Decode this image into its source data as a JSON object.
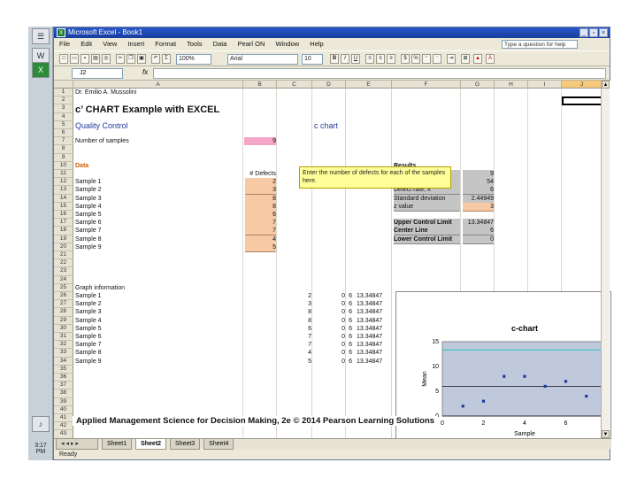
{
  "window": {
    "title": "Microsoft Excel - Book1",
    "min": "_",
    "max": "▫",
    "close": "×"
  },
  "menu": [
    "File",
    "Edit",
    "View",
    "Insert",
    "Format",
    "Tools",
    "Data",
    "Pearl ON",
    "Window",
    "Help"
  ],
  "help_box": {
    "placeholder": "Type a question for help"
  },
  "toolbar": {
    "zoom": "100%",
    "font": "Arial",
    "font_size": "10"
  },
  "formula_bar": {
    "name_box": "J2",
    "fx": "fx",
    "content": ""
  },
  "columns": [
    {
      "label": "",
      "w": 0
    },
    {
      "label": "A"
    },
    {
      "label": "B"
    },
    {
      "label": "C"
    },
    {
      "label": "D"
    },
    {
      "label": "E"
    },
    {
      "label": "F"
    },
    {
      "label": "G"
    },
    {
      "label": "H"
    },
    {
      "label": "I"
    },
    {
      "label": "J"
    }
  ],
  "rows": [
    "1",
    "2",
    "3",
    "4",
    "5",
    "6",
    "7",
    "8",
    "9",
    "10",
    "11",
    "12",
    "13",
    "14",
    "15",
    "16",
    "17",
    "18",
    "19",
    "20",
    "21",
    "22",
    "23",
    "24",
    "25",
    "26",
    "27",
    "28",
    "29",
    "30",
    "31",
    "32",
    "33",
    "34",
    "35",
    "36",
    "37",
    "38",
    "39",
    "40",
    "41",
    "42",
    "43"
  ],
  "sheet": {
    "author": "Dr. Emilio A. Mussolini",
    "title": "c’ CHART Example with EXCEL",
    "qc_label": "Quality Control",
    "chart_label": "c chart",
    "num_samples_label": "Number of samples",
    "num_samples_value": "9",
    "comment": "Enter the number of defects for each of the samples here.",
    "data_label": "Data",
    "defects_header": "# Defects",
    "samples": [
      {
        "name": "Sample 1",
        "defects": "2"
      },
      {
        "name": "Sample 2",
        "defects": "3"
      },
      {
        "name": "Sample 3",
        "defects": "8"
      },
      {
        "name": "Sample 4",
        "defects": "8"
      },
      {
        "name": "Sample 5",
        "defects": "6"
      },
      {
        "name": "Sample 6",
        "defects": "7"
      },
      {
        "name": "Sample 7",
        "defects": "7"
      },
      {
        "name": "Sample 8",
        "defects": "4"
      },
      {
        "name": "Sample 9",
        "defects": "5"
      }
    ],
    "results": {
      "header": "Results",
      "rows": [
        {
          "label": "Total units sampled",
          "value": "9"
        },
        {
          "label": "Total Defects",
          "value": "54"
        },
        {
          "label": "Defect rate, λ",
          "value": "6"
        },
        {
          "label": "Standard deviation",
          "value": "2.44949"
        },
        {
          "label": "z value",
          "value": "3"
        }
      ],
      "limits": [
        {
          "label": "Upper Control Limit",
          "value": "13.34847"
        },
        {
          "label": "Center Line",
          "value": "6"
        },
        {
          "label": "Lower Control Limit",
          "value": "0"
        }
      ]
    },
    "graph_info": {
      "label": "Graph information",
      "rows": [
        {
          "name": "Sample 1",
          "c": "2",
          "lcl": "0",
          "cl": "6",
          "ucl": "13.34847"
        },
        {
          "name": "Sample 2",
          "c": "3",
          "lcl": "0",
          "cl": "6",
          "ucl": "13.34847"
        },
        {
          "name": "Sample 3",
          "c": "8",
          "lcl": "0",
          "cl": "6",
          "ucl": "13.34847"
        },
        {
          "name": "Sample 4",
          "c": "8",
          "lcl": "0",
          "cl": "6",
          "ucl": "13.34847"
        },
        {
          "name": "Sample 5",
          "c": "6",
          "lcl": "0",
          "cl": "6",
          "ucl": "13.34847"
        },
        {
          "name": "Sample 6",
          "c": "7",
          "lcl": "0",
          "cl": "6",
          "ucl": "13.34847"
        },
        {
          "name": "Sample 7",
          "c": "7",
          "lcl": "0",
          "cl": "6",
          "ucl": "13.34847"
        },
        {
          "name": "Sample 8",
          "c": "4",
          "lcl": "0",
          "cl": "6",
          "ucl": "13.34847"
        },
        {
          "name": "Sample 9",
          "c": "5",
          "lcl": "0",
          "cl": "6",
          "ucl": "13.34847"
        }
      ]
    }
  },
  "chart_data": {
    "type": "scatter",
    "title": "c-chart",
    "xlabel": "Sample",
    "ylabel": "Mean",
    "xlim": [
      0,
      8
    ],
    "ylim": [
      0,
      15
    ],
    "xticks": [
      0,
      2,
      4,
      6,
      8
    ],
    "yticks": [
      0,
      5,
      10,
      15
    ],
    "points": [
      [
        1,
        2
      ],
      [
        2,
        3
      ],
      [
        3,
        8
      ],
      [
        4,
        8
      ],
      [
        5,
        6
      ],
      [
        6,
        7
      ],
      [
        7,
        4
      ]
    ],
    "ucl": 13.34847,
    "cl": 6,
    "lcl": 0,
    "colors": {
      "points": "#1f3b9a",
      "ucl": "#3fc7c7",
      "cl": "#111111",
      "plot_bg": "#c0c8dc"
    }
  },
  "sheet_tabs": [
    "Sheet1",
    "Sheet2",
    "Sheet3",
    "Sheet4"
  ],
  "active_tab": 1,
  "status": "Ready",
  "footer": "Applied Management Science for Decision Making, 2e © 2014 Pearson Learning Solutions",
  "clock": "3:17 PM"
}
